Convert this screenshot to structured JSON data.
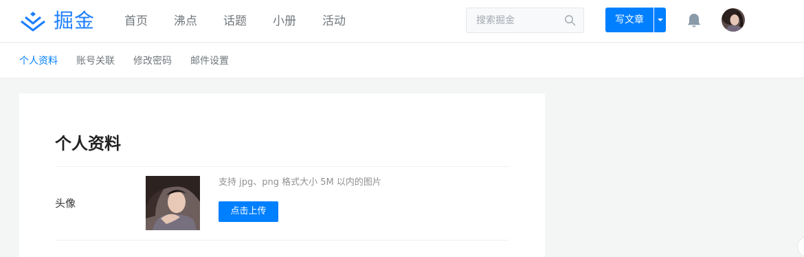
{
  "header": {
    "logo_text": "掘金",
    "nav": [
      {
        "label": "首页"
      },
      {
        "label": "沸点"
      },
      {
        "label": "话题"
      },
      {
        "label": "小册"
      },
      {
        "label": "活动"
      }
    ],
    "search": {
      "placeholder": "搜索掘金",
      "value": ""
    },
    "write_button_label": "写文章"
  },
  "subnav": [
    {
      "label": "个人资料",
      "active": true
    },
    {
      "label": "账号关联",
      "active": false
    },
    {
      "label": "修改密码",
      "active": false
    },
    {
      "label": "邮件设置",
      "active": false
    }
  ],
  "profile": {
    "title": "个人资料",
    "avatar_field": {
      "label": "头像",
      "hint": "支持 jpg、png 格式大小 5M 以内的图片",
      "upload_label": "点击上传"
    }
  },
  "colors": {
    "brand": "#1e80ff",
    "button": "#007fff",
    "page_bg": "#f4f5f5"
  },
  "icons": [
    "juejin-logo-icon",
    "search-icon",
    "chevron-down-icon",
    "bell-icon"
  ]
}
